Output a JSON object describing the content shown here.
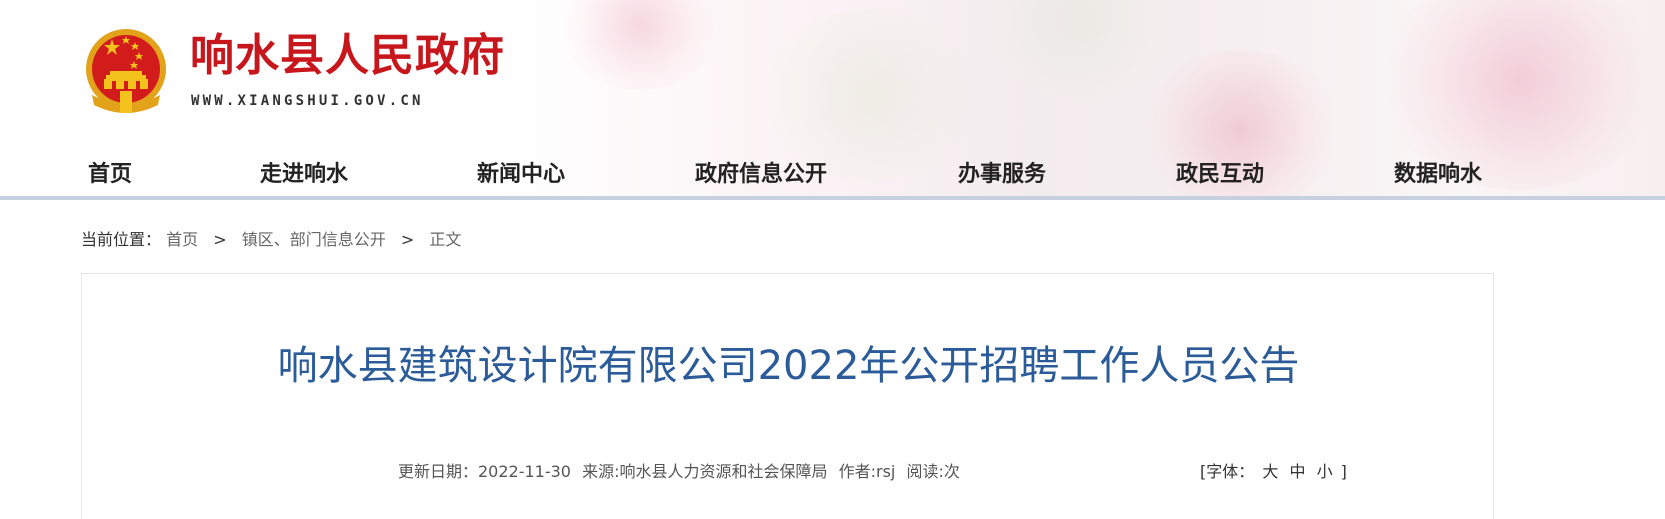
{
  "header": {
    "site_title": "响水县人民政府",
    "site_url": "WWW.XIANGSHUI.GOV.CN",
    "emblem_icon": "national-emblem-icon",
    "colors": {
      "title_red": "#c8161d",
      "nav_line": "#c7d0e2"
    }
  },
  "nav": {
    "items": [
      {
        "label": "首页"
      },
      {
        "label": "走进响水"
      },
      {
        "label": "新闻中心"
      },
      {
        "label": "政府信息公开"
      },
      {
        "label": "办事服务"
      },
      {
        "label": "政民互动"
      },
      {
        "label": "数据响水"
      }
    ]
  },
  "breadcrumb": {
    "prefix": "当前位置：",
    "items": [
      "首页",
      "镇区、部门信息公开",
      "正文"
    ],
    "separator": ">"
  },
  "article": {
    "title": "响水县建筑设计院有限公司2022年公开招聘工作人员公告",
    "title_color": "#2b5c99",
    "meta": {
      "updated": "更新日期：2022-11-30",
      "source": "来源:响水县人力资源和社会保障局",
      "author": "作者:rsj",
      "reads": "阅读:次"
    },
    "font_size": {
      "open": "[字体：",
      "large": "大",
      "medium": "中",
      "small": "小",
      "close": "]"
    }
  }
}
